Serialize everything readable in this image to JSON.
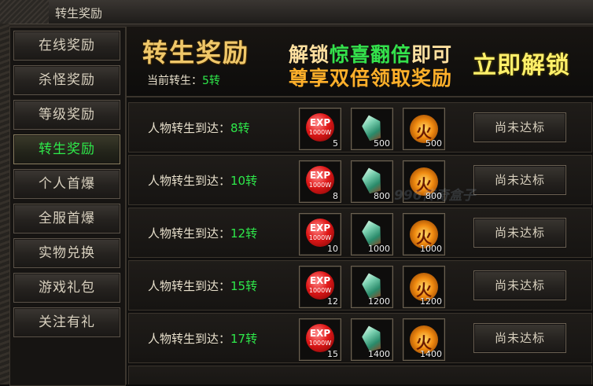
{
  "window": {
    "title": "转生奖励"
  },
  "sidebar": {
    "items": [
      {
        "label": "在线奖励",
        "active": false
      },
      {
        "label": "杀怪奖励",
        "active": false
      },
      {
        "label": "等级奖励",
        "active": false
      },
      {
        "label": "转生奖励",
        "active": true
      },
      {
        "label": "个人首爆",
        "active": false
      },
      {
        "label": "全服首爆",
        "active": false
      },
      {
        "label": "实物兑换",
        "active": false
      },
      {
        "label": "游戏礼包",
        "active": false
      },
      {
        "label": "关注有礼",
        "active": false
      }
    ]
  },
  "header": {
    "title": "转生奖励",
    "current_label": "当前转生：",
    "current_value": "5转",
    "promo_line1_a": "解锁",
    "promo_line1_b": "惊喜翻倍",
    "promo_line1_c": "即可",
    "promo_line2": "尊享双倍领取奖励",
    "unlock_button": "立即解锁"
  },
  "rows": [
    {
      "label": "人物转生到达：",
      "level": "8转",
      "rewards": [
        {
          "icon": "exp-orb-icon",
          "text": "EXP",
          "sub": "1000W",
          "count": "5"
        },
        {
          "icon": "crystal-gem-icon",
          "count": "500"
        },
        {
          "icon": "fire-token-icon",
          "text": "火",
          "count": "500"
        }
      ],
      "button": "尚未达标"
    },
    {
      "label": "人物转生到达：",
      "level": "10转",
      "rewards": [
        {
          "icon": "exp-orb-icon",
          "text": "EXP",
          "sub": "1000W",
          "count": "8"
        },
        {
          "icon": "crystal-gem-icon",
          "count": "800"
        },
        {
          "icon": "fire-token-icon",
          "text": "火",
          "count": "800"
        }
      ],
      "button": "尚未达标"
    },
    {
      "label": "人物转生到达：",
      "level": "12转",
      "rewards": [
        {
          "icon": "exp-orb-icon",
          "text": "EXP",
          "sub": "1000W",
          "count": "10"
        },
        {
          "icon": "crystal-gem-icon",
          "count": "1000"
        },
        {
          "icon": "fire-token-icon",
          "text": "火",
          "count": "1000"
        }
      ],
      "button": "尚未达标"
    },
    {
      "label": "人物转生到达：",
      "level": "15转",
      "rewards": [
        {
          "icon": "exp-orb-icon",
          "text": "EXP",
          "sub": "1000W",
          "count": "12"
        },
        {
          "icon": "crystal-gem-icon",
          "count": "1200"
        },
        {
          "icon": "fire-token-icon",
          "text": "火",
          "count": "1200"
        }
      ],
      "button": "尚未达标"
    },
    {
      "label": "人物转生到达：",
      "level": "17转",
      "rewards": [
        {
          "icon": "exp-orb-icon",
          "text": "EXP",
          "sub": "1000W",
          "count": "15"
        },
        {
          "icon": "crystal-gem-icon",
          "count": "1400"
        },
        {
          "icon": "fire-token-icon",
          "text": "火",
          "count": "1400"
        }
      ],
      "button": "尚未达标"
    }
  ],
  "watermark": "996传奇盒子",
  "colors": {
    "accent_green": "#2ee84a",
    "title_gold": "#f0c86a",
    "promo_orange": "#ffb02a",
    "unlock_yellow": "#fff06a"
  }
}
